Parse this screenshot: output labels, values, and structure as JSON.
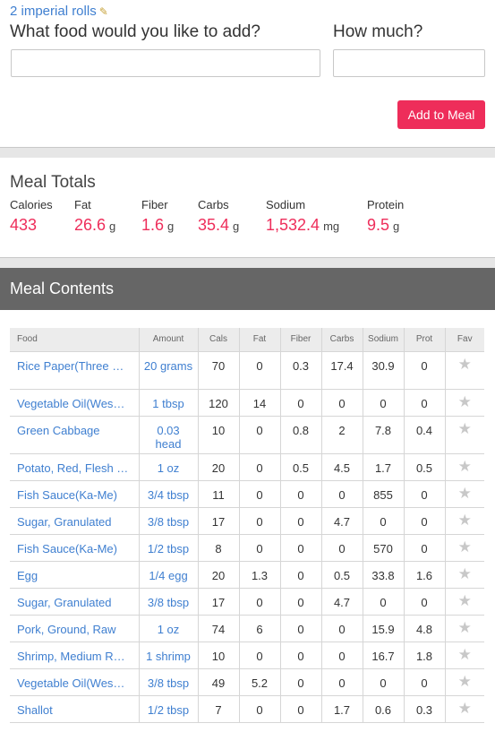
{
  "meal": {
    "name": "2 imperial rolls",
    "edit_icon": "pencil-icon"
  },
  "add_form": {
    "food_question": "What food would you like to add?",
    "amount_question": "How much?",
    "food_value": "",
    "amount_value": "",
    "add_button": "Add to Meal"
  },
  "totals": {
    "title": "Meal Totals",
    "items": [
      {
        "label": "Calories",
        "value": "433",
        "unit": ""
      },
      {
        "label": "Fat",
        "value": "26.6",
        "unit": "g"
      },
      {
        "label": "Fiber",
        "value": "1.6",
        "unit": "g"
      },
      {
        "label": "Carbs",
        "value": "35.4",
        "unit": "g"
      },
      {
        "label": "Sodium",
        "value": "1,532.4",
        "unit": "mg"
      },
      {
        "label": "Protein",
        "value": "9.5",
        "unit": "g"
      }
    ]
  },
  "contents": {
    "title": "Meal Contents",
    "columns": [
      "Food",
      "Amount",
      "Cals",
      "Fat",
      "Fiber",
      "Carbs",
      "Sodium",
      "Prot",
      "Fav"
    ],
    "fav_icon": "star-icon",
    "rows": [
      {
        "food": "Rice Paper(Three …",
        "amount": "20 grams",
        "cals": "70",
        "fat": "0",
        "fiber": "0.3",
        "carbs": "17.4",
        "sodium": "30.9",
        "prot": "0"
      },
      {
        "food": "Vegetable Oil(Wes…",
        "amount": "1 tbsp",
        "cals": "120",
        "fat": "14",
        "fiber": "0",
        "carbs": "0",
        "sodium": "0",
        "prot": "0"
      },
      {
        "food": "Green Cabbage",
        "amount": "0.03 head",
        "cals": "10",
        "fat": "0",
        "fiber": "0.8",
        "carbs": "2",
        "sodium": "7.8",
        "prot": "0.4"
      },
      {
        "food": "Potato, Red, Flesh …",
        "amount": "1 oz",
        "cals": "20",
        "fat": "0",
        "fiber": "0.5",
        "carbs": "4.5",
        "sodium": "1.7",
        "prot": "0.5"
      },
      {
        "food": "Fish Sauce(Ka-Me)",
        "amount": "3/4 tbsp",
        "cals": "11",
        "fat": "0",
        "fiber": "0",
        "carbs": "0",
        "sodium": "855",
        "prot": "0"
      },
      {
        "food": "Sugar, Granulated",
        "amount": "3/8 tbsp",
        "cals": "17",
        "fat": "0",
        "fiber": "0",
        "carbs": "4.7",
        "sodium": "0",
        "prot": "0"
      },
      {
        "food": "Fish Sauce(Ka-Me)",
        "amount": "1/2 tbsp",
        "cals": "8",
        "fat": "0",
        "fiber": "0",
        "carbs": "0",
        "sodium": "570",
        "prot": "0"
      },
      {
        "food": "Egg",
        "amount": "1/4 egg",
        "cals": "20",
        "fat": "1.3",
        "fiber": "0",
        "carbs": "0.5",
        "sodium": "33.8",
        "prot": "1.6"
      },
      {
        "food": "Sugar, Granulated",
        "amount": "3/8 tbsp",
        "cals": "17",
        "fat": "0",
        "fiber": "0",
        "carbs": "4.7",
        "sodium": "0",
        "prot": "0"
      },
      {
        "food": "Pork, Ground, Raw",
        "amount": "1 oz",
        "cals": "74",
        "fat": "6",
        "fiber": "0",
        "carbs": "0",
        "sodium": "15.9",
        "prot": "4.8"
      },
      {
        "food": "Shrimp, Medium R…",
        "amount": "1 shrimp",
        "cals": "10",
        "fat": "0",
        "fiber": "0",
        "carbs": "0",
        "sodium": "16.7",
        "prot": "1.8"
      },
      {
        "food": "Vegetable Oil(Wes…",
        "amount": "3/8 tbsp",
        "cals": "49",
        "fat": "5.2",
        "fiber": "0",
        "carbs": "0",
        "sodium": "0",
        "prot": "0"
      },
      {
        "food": "Shallot",
        "amount": "1/2 tbsp",
        "cals": "7",
        "fat": "0",
        "fiber": "0",
        "carbs": "1.7",
        "sodium": "0.6",
        "prot": "0.3"
      }
    ]
  }
}
